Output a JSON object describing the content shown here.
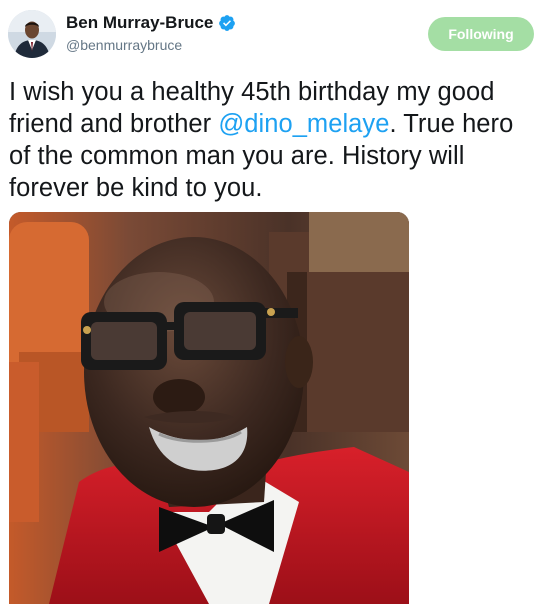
{
  "author": {
    "name": "Ben Murray-Bruce",
    "handle": "@benmurraybruce",
    "verified": true,
    "avatar_icon": "profile-photo",
    "verified_icon": "verified-badge-icon"
  },
  "follow_button": {
    "label": "Following",
    "color": "#a4dea4"
  },
  "tweet": {
    "lines": [
      [
        {
          "text": "I wish you a healthy 45th birthday my good"
        }
      ],
      [
        {
          "text": "friend and brother "
        },
        {
          "text": "@dino_melaye",
          "mention": true
        },
        {
          "text": ". True hero"
        }
      ],
      [
        {
          "text": "of the common man you are. History will"
        }
      ],
      [
        {
          "text": "forever be kind to you."
        }
      ]
    ],
    "mention_color": "#1da1f2"
  },
  "media": {
    "type": "photo",
    "description_icon": "tweet-photo"
  }
}
